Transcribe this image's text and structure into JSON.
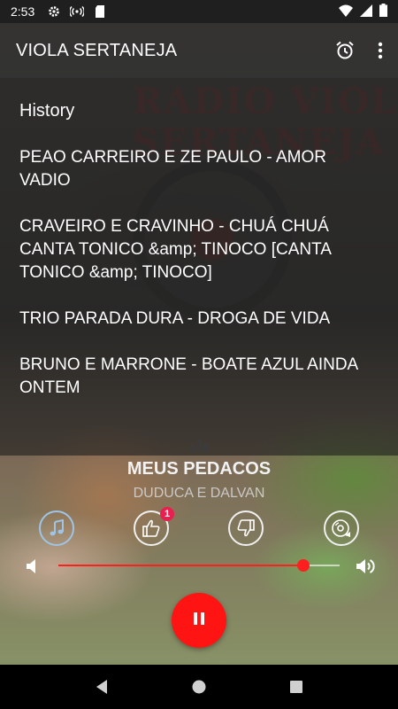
{
  "status_bar": {
    "time": "2:53",
    "icons": [
      "settings-icon",
      "hotspot-icon",
      "sd-card-icon",
      "wifi-icon",
      "signal-icon",
      "battery-icon"
    ]
  },
  "app_bar": {
    "title": "VIOLA SERTANEJA",
    "actions": [
      "alarm-icon",
      "more-vert-icon"
    ]
  },
  "history": {
    "heading": "History",
    "items": [
      "PEAO CARREIRO E ZE PAULO - AMOR VADIO",
      "CRAVEIRO E CRAVINHO - CHUÁ CHUÁ CANTA TONICO &amp; TINOCO  [CANTA TONICO &amp; TINOCO]",
      "TRIO PARADA DURA - DROGA DE VIDA",
      "BRUNO E MARRONE - BOATE AZUL AINDA ONTEM"
    ]
  },
  "now_playing": {
    "title": "MEUS PEDACOS",
    "artist": "DUDUCA E DALVAN"
  },
  "actions": {
    "like_count": "1",
    "icons": [
      "music-note-icon",
      "thumbs-up-icon",
      "thumbs-down-icon",
      "record-icon"
    ]
  },
  "volume": {
    "level": 0.87,
    "accent": "#ff1f1f"
  },
  "playback": {
    "state_icon": "pause-icon",
    "color": "#ff1414"
  },
  "nav": [
    "back-icon",
    "home-icon",
    "recents-icon"
  ]
}
